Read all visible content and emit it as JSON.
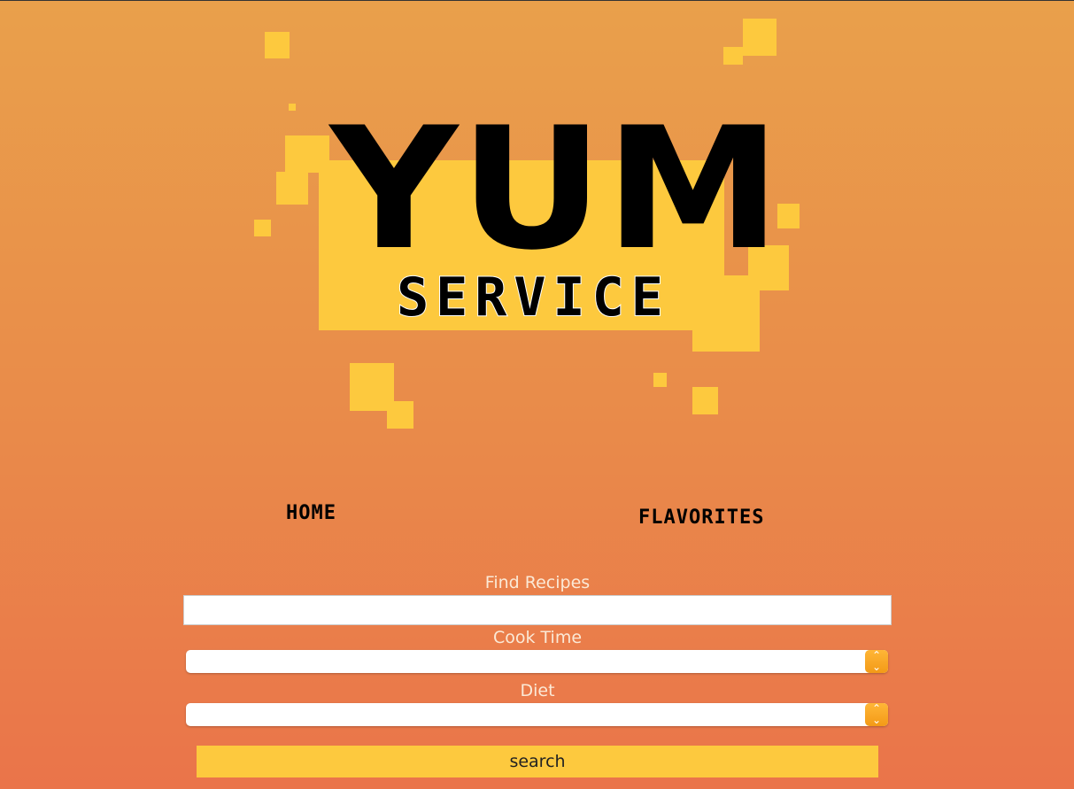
{
  "logo": {
    "word": "YUM",
    "subword": "SERVICE",
    "colors": {
      "accent": "#fdc93e",
      "text": "#000000"
    }
  },
  "nav": {
    "home": "HOME",
    "favorites": "FLAVORITES"
  },
  "form": {
    "find_label": "Find Recipes",
    "find_value": "",
    "cook_label": "Cook Time",
    "cook_value": "",
    "diet_label": "Diet",
    "diet_value": "",
    "search_label": "search"
  },
  "icons": {
    "select_arrows": "chevron-up-down-icon"
  },
  "colors": {
    "background_top": "#e9a04b",
    "background_bottom": "#ea744a",
    "accent": "#fdc93e",
    "label_text": "#fbe9d6"
  }
}
